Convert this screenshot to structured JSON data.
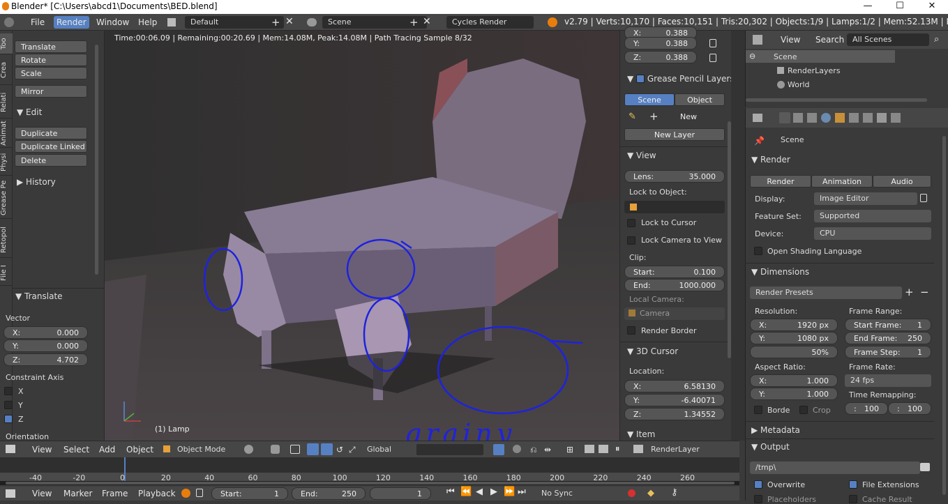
{
  "window": {
    "title": "Blender* [C:\\Users\\abcd1\\Documents\\BED.blend]",
    "minimize": "—",
    "maximize": "☐",
    "close": "✕"
  },
  "infobar": {
    "menus": [
      "File",
      "Render",
      "Window",
      "Help"
    ],
    "screen_layout": "Default",
    "scene": "Scene",
    "engine": "Cycles Render",
    "stats": "v2.79 | Verts:10,170 | Faces:10,151 | Tris:20,302 | Objects:1/9 | Lamps:1/2 | Mem:52.13M | Lamp"
  },
  "side_tabs": [
    "Too",
    "Crea",
    "Relati",
    "Animat",
    "Physi",
    "Grease Pe",
    "Retopol",
    "File I"
  ],
  "toolshelf": {
    "transform_buttons": [
      "Translate",
      "Rotate",
      "Scale"
    ],
    "mirror": "Mirror",
    "edit_header": "Edit",
    "edit_buttons": [
      "Duplicate",
      "Duplicate Linked",
      "Delete"
    ],
    "history_header": "History",
    "operator_header": "Translate",
    "vector_label": "Vector",
    "vector": [
      {
        "axis": "X:",
        "value": "0.000"
      },
      {
        "axis": "Y:",
        "value": "0.000"
      },
      {
        "axis": "Z:",
        "value": "4.702"
      }
    ],
    "constraint_label": "Constraint Axis",
    "constraint": [
      {
        "axis": "X",
        "checked": false
      },
      {
        "axis": "Y",
        "checked": false
      },
      {
        "axis": "Z",
        "checked": true
      }
    ],
    "orientation_label": "Orientation"
  },
  "viewport": {
    "render_status": "Time:00:06.09 | Remaining:00:20.69 | Mem:14.08M, Peak:14.08M | Path Tracing Sample 8/32",
    "object_label": "(1) Lamp",
    "annotation_text": "grainy"
  },
  "npanel": {
    "top_fields": [
      {
        "axis": "X:",
        "value": "0.388"
      },
      {
        "axis": "Y:",
        "value": "0.388"
      },
      {
        "axis": "Z:",
        "value": "0.388"
      }
    ],
    "grease_header": "Grease Pencil Layers",
    "grease_tabs": [
      "Scene",
      "Object"
    ],
    "new_label": "New",
    "new_layer": "New Layer",
    "view_header": "View",
    "lens_label": "Lens:",
    "lens_value": "35.000",
    "lock_object": "Lock to Object:",
    "lock_cursor": "Lock to Cursor",
    "lock_camera": "Lock Camera to View",
    "clip_label": "Clip:",
    "clip_start_label": "Start:",
    "clip_start": "0.100",
    "clip_end_label": "End:",
    "clip_end": "1000.000",
    "local_camera": "Local Camera:",
    "camera_placeholder": "Camera",
    "render_border": "Render Border",
    "cursor_header": "3D Cursor",
    "location_label": "Location:",
    "cursor": [
      {
        "axis": "X:",
        "value": "6.58130"
      },
      {
        "axis": "Y:",
        "value": "-6.40071"
      },
      {
        "axis": "Z:",
        "value": "1.34552"
      }
    ],
    "item_header": "Item"
  },
  "outliner": {
    "view": "View",
    "search": "Search",
    "filter": "All Scenes",
    "items": [
      "Scene",
      "RenderLayers",
      "World"
    ]
  },
  "properties": {
    "context": "Scene",
    "render_header": "Render",
    "render_buttons": [
      "Render",
      "Animation",
      "Audio"
    ],
    "display_label": "Display:",
    "display": "Image Editor",
    "feature_label": "Feature Set:",
    "feature": "Supported",
    "device_label": "Device:",
    "device": "CPU",
    "osl": "Open Shading Language",
    "dimensions_header": "Dimensions",
    "presets": "Render Presets",
    "resolution_label": "Resolution:",
    "res_x": "1920 px",
    "res_y": "1080 px",
    "res_pct": "50%",
    "frame_range_label": "Frame Range:",
    "start_frame_label": "Start Frame:",
    "start_frame": "1",
    "end_frame_label": "End Frame:",
    "end_frame": "250",
    "frame_step_label": "Frame Step:",
    "frame_step": "1",
    "aspect_label": "Aspect Ratio:",
    "aspect_x": "1.000",
    "aspect_y": "1.000",
    "frame_rate_label": "Frame Rate:",
    "frame_rate": "24 fps",
    "border": "Borde",
    "crop": "Crop",
    "time_remap": "Time Remapping:",
    "remap_old": "100",
    "remap_new": "100",
    "metadata_header": "Metadata",
    "output_header": "Output",
    "output_path": "/tmp\\",
    "overwrite": "Overwrite",
    "file_ext": "File Extensions",
    "placeholders": "Placeholders",
    "cache_result": "Cache Result"
  },
  "viewport_header": {
    "menus": [
      "View",
      "Select",
      "Add",
      "Object"
    ],
    "mode": "Object Mode",
    "orientation": "Global",
    "layer": "RenderLayer"
  },
  "timeline": {
    "ticks": [
      "-40",
      "-20",
      "0",
      "20",
      "40",
      "60",
      "80",
      "100",
      "120",
      "140",
      "160",
      "180",
      "200",
      "220",
      "240",
      "260"
    ],
    "current_frame": 1
  },
  "timeline_header": {
    "menus": [
      "View",
      "Marker",
      "Frame",
      "Playback"
    ],
    "start_label": "Start:",
    "start": "1",
    "end_label": "End:",
    "end": "250",
    "current": "1",
    "sync": "No Sync"
  },
  "colors": {
    "accent": "#5680c2",
    "annotation": "#1e22e0",
    "cursor_line": "#5680c2"
  }
}
